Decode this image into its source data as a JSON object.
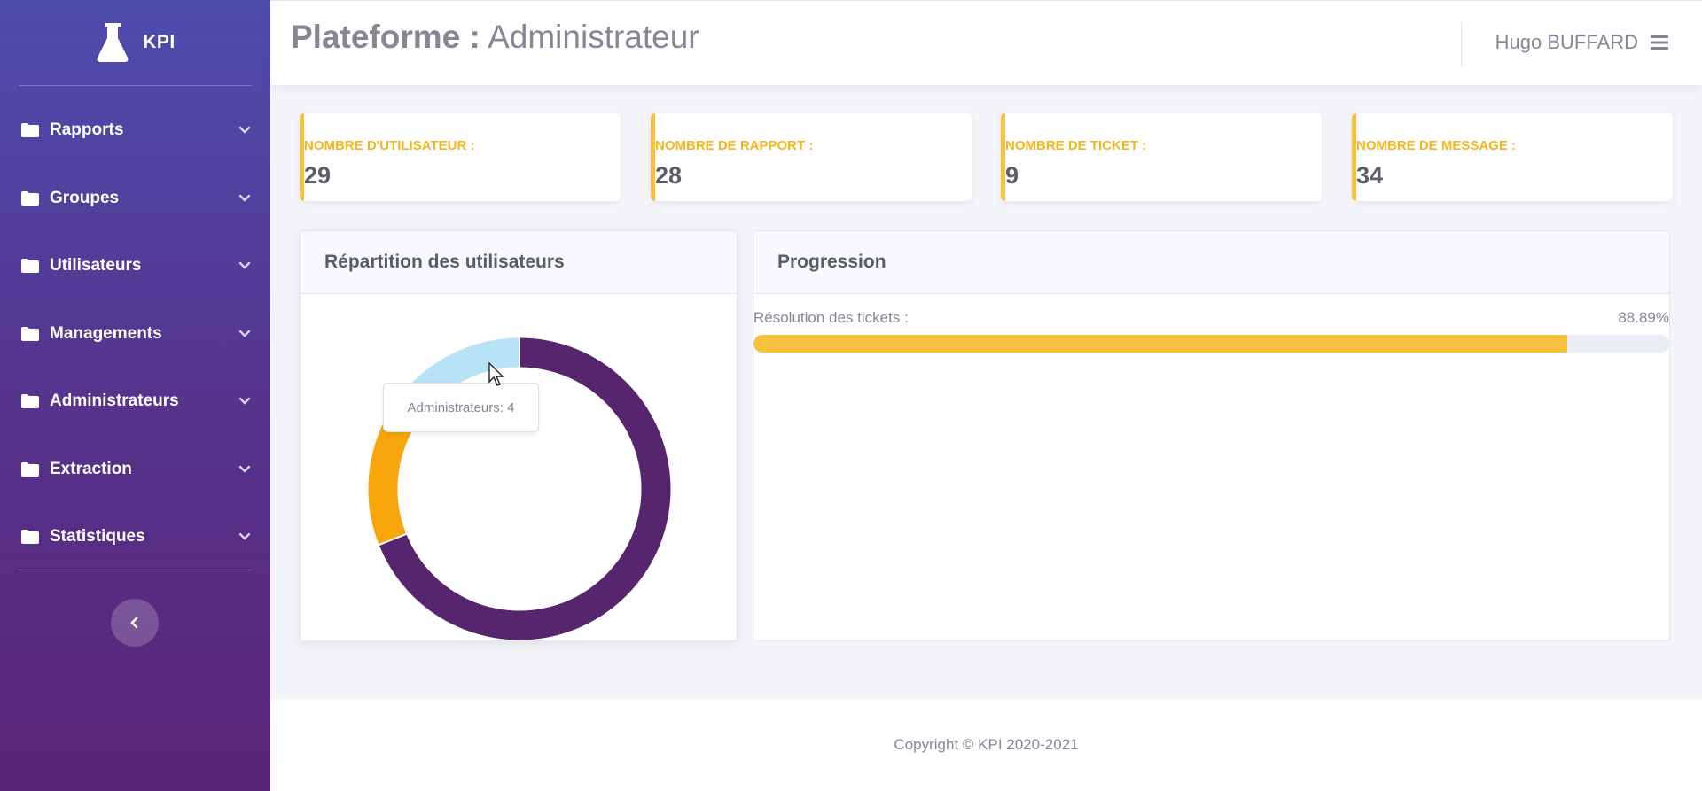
{
  "brand": {
    "name": "KPI",
    "logo_icon": "flask-icon"
  },
  "sidebar": {
    "items": [
      {
        "label": "Rapports"
      },
      {
        "label": "Groupes"
      },
      {
        "label": "Utilisateurs"
      },
      {
        "label": "Managements"
      },
      {
        "label": "Administrateurs"
      },
      {
        "label": "Extraction"
      },
      {
        "label": "Statistiques"
      }
    ],
    "collapse_icon": "chevron-left-icon"
  },
  "header": {
    "title_bold": "Plateforme :",
    "title_light": "Administrateur",
    "user_name": "Hugo BUFFARD",
    "menu_icon": "hamburger-icon"
  },
  "stats": [
    {
      "label": "NOMBRE D'UTILISATEUR :",
      "value": "29"
    },
    {
      "label": "NOMBRE DE RAPPORT :",
      "value": "28"
    },
    {
      "label": "NOMBRE DE TICKET :",
      "value": "9"
    },
    {
      "label": "NOMBRE DE MESSAGE :",
      "value": "34"
    }
  ],
  "distribution_panel": {
    "title": "Répartition des utilisateurs",
    "tooltip": "Administrateurs: 4"
  },
  "progress_panel": {
    "title": "Progression",
    "label": "Résolution des tickets :",
    "value_text": "88.89%",
    "value": 88.89
  },
  "chart_data": {
    "type": "pie",
    "categories": [
      "",
      "",
      "Administrateurs"
    ],
    "values": [
      20,
      5,
      4
    ],
    "colors": [
      "#56256e",
      "#f6a60a",
      "#b8e2f5"
    ],
    "hovered": "Administrateurs"
  },
  "footer": {
    "copyright": "Copyright © KPI 2020-2021"
  },
  "colors": {
    "accent": "#f6c23e",
    "sidebar_top": "#4e4cae",
    "sidebar_bottom": "#5a2477"
  }
}
